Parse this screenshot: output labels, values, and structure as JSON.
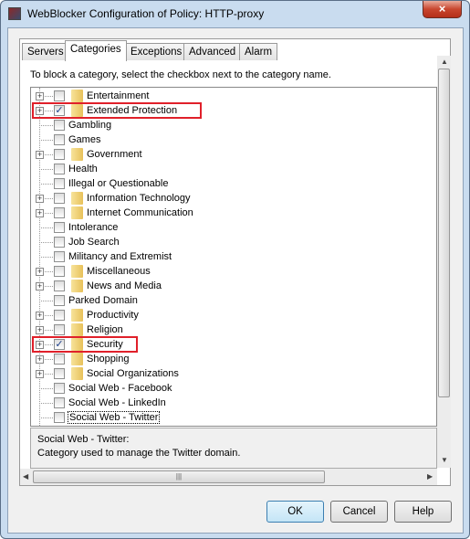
{
  "window": {
    "title": "WebBlocker Configuration of Policy: HTTP-proxy",
    "close_icon": "×"
  },
  "tabs": [
    {
      "label": "Servers",
      "active": false
    },
    {
      "label": "Categories",
      "active": true
    },
    {
      "label": "Exceptions",
      "active": false
    },
    {
      "label": "Advanced",
      "active": false
    },
    {
      "label": "Alarm",
      "active": false
    }
  ],
  "instruction": "To block a category, select the checkbox next to the category name.",
  "categories": [
    {
      "label": "Entertainment",
      "folder": true,
      "checked": false
    },
    {
      "label": "Extended Protection",
      "folder": true,
      "checked": true,
      "highlighted": true
    },
    {
      "label": "Gambling",
      "folder": false,
      "checked": false
    },
    {
      "label": "Games",
      "folder": false,
      "checked": false
    },
    {
      "label": "Government",
      "folder": true,
      "checked": false
    },
    {
      "label": "Health",
      "folder": false,
      "checked": false
    },
    {
      "label": "Illegal or Questionable",
      "folder": false,
      "checked": false
    },
    {
      "label": "Information Technology",
      "folder": true,
      "checked": false
    },
    {
      "label": "Internet Communication",
      "folder": true,
      "checked": false
    },
    {
      "label": "Intolerance",
      "folder": false,
      "checked": false
    },
    {
      "label": "Job Search",
      "folder": false,
      "checked": false
    },
    {
      "label": "Militancy and Extremist",
      "folder": false,
      "checked": false
    },
    {
      "label": "Miscellaneous",
      "folder": true,
      "checked": false
    },
    {
      "label": "News and Media",
      "folder": true,
      "checked": false
    },
    {
      "label": "Parked Domain",
      "folder": false,
      "checked": false
    },
    {
      "label": "Productivity",
      "folder": true,
      "checked": false
    },
    {
      "label": "Religion",
      "folder": true,
      "checked": false
    },
    {
      "label": "Security",
      "folder": true,
      "checked": true,
      "highlighted": true
    },
    {
      "label": "Shopping",
      "folder": true,
      "checked": false
    },
    {
      "label": "Social Organizations",
      "folder": true,
      "checked": false
    },
    {
      "label": "Social Web - Facebook",
      "folder": false,
      "checked": false
    },
    {
      "label": "Social Web - LinkedIn",
      "folder": false,
      "checked": false
    },
    {
      "label": "Social Web - Twitter",
      "folder": false,
      "checked": false,
      "focused": true
    }
  ],
  "description": {
    "title": "Social Web - Twitter:",
    "text": "Category used to manage the Twitter domain."
  },
  "buttons": {
    "ok": "OK",
    "cancel": "Cancel",
    "help": "Help"
  },
  "colors": {
    "highlight": "#e0202a",
    "check": "#1d3f8a"
  }
}
